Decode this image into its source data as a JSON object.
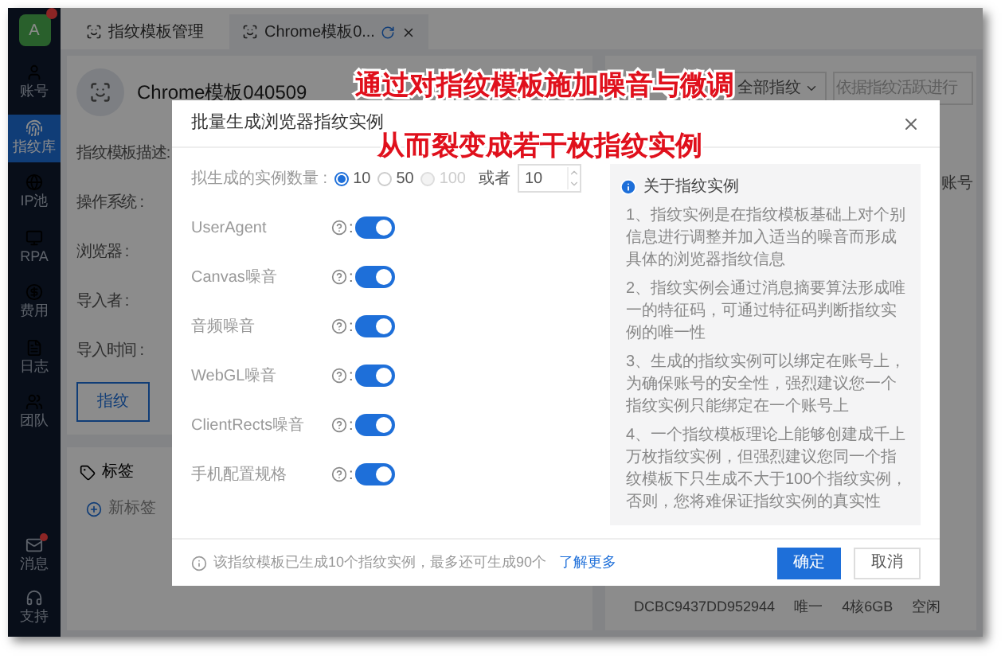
{
  "sidebar": {
    "avatar": "A",
    "items": [
      {
        "label": "账号",
        "selected": false
      },
      {
        "label": "指纹库",
        "selected": true
      },
      {
        "label": "IP池",
        "selected": false
      },
      {
        "label": "RPA",
        "selected": false
      },
      {
        "label": "费用",
        "selected": false
      },
      {
        "label": "日志",
        "selected": false
      },
      {
        "label": "团队",
        "selected": false
      }
    ],
    "bottom_items": [
      {
        "label": "消息",
        "badge": true
      },
      {
        "label": "支持",
        "badge": false
      }
    ]
  },
  "tabs": [
    {
      "label": "指纹模板管理",
      "selected": false
    },
    {
      "label": "Chrome模板0...",
      "selected": true
    }
  ],
  "template": {
    "title": "Chrome模板040509",
    "fields": [
      "指纹模板描述:",
      "操作系统 :",
      "浏览器 :",
      "导入者 :",
      "导入时间 :"
    ],
    "button": "指纹"
  },
  "tags": {
    "title": "标签",
    "add": "新标签"
  },
  "filter": {
    "dropdown": "全部指纹",
    "placeholder": "依据指纹活跃进行"
  },
  "table": {
    "column": "账号",
    "row": [
      "DCBC9437DD952944",
      "唯一",
      "4核6GB",
      "空闲"
    ]
  },
  "annotations": [
    "通过对指纹模板施加噪音与微调",
    "从而裂变成若干枚指纹实例"
  ],
  "dialog": {
    "title": "批量生成浏览器指纹实例",
    "count": {
      "label": "拟生成的实例数量 :",
      "options": [
        {
          "label": "10",
          "selected": true,
          "disabled": false
        },
        {
          "label": "50",
          "selected": false,
          "disabled": false
        },
        {
          "label": "100",
          "selected": false,
          "disabled": true
        }
      ],
      "or": "或者",
      "value": "10"
    },
    "toggles": [
      {
        "label": "UserAgent",
        "colon": ":",
        "on": true
      },
      {
        "label": "Canvas噪音",
        "colon": ":",
        "on": true
      },
      {
        "label": "音频噪音",
        "colon": ":",
        "on": true
      },
      {
        "label": "WebGL噪音",
        "colon": ":",
        "on": true
      },
      {
        "label": "ClientRects噪音",
        "colon": ":",
        "on": true
      },
      {
        "label": "手机配置规格",
        "colon": ":",
        "on": true
      }
    ],
    "info": {
      "title": "关于指纹实例",
      "paragraphs": [
        "1、指纹实例是在指纹模板基础上对个别信息进行调整并加入适当的噪音而形成具体的浏览器指纹信息",
        "2、指纹实例会通过消息摘要算法形成唯一的特征码，可通过特征码判断指纹实例的唯一性",
        "3、生成的指纹实例可以绑定在账号上，为确保账号的安全性，强烈建议您一个指纹实例只能绑定在一个账号上",
        "4、一个指纹模板理论上能够创建成千上万枚指纹实例，但强烈建议您同一个指纹模板下只生成不大于100个指纹实例，否则，您将难保证指纹实例的真实性"
      ]
    },
    "footer": {
      "note": "该指纹模板已生成10个指纹实例，最多还可生成90个",
      "link": "了解更多",
      "buttons": [
        {
          "label": "确定",
          "kind": "primary"
        },
        {
          "label": "取消",
          "kind": "default"
        }
      ]
    }
  }
}
